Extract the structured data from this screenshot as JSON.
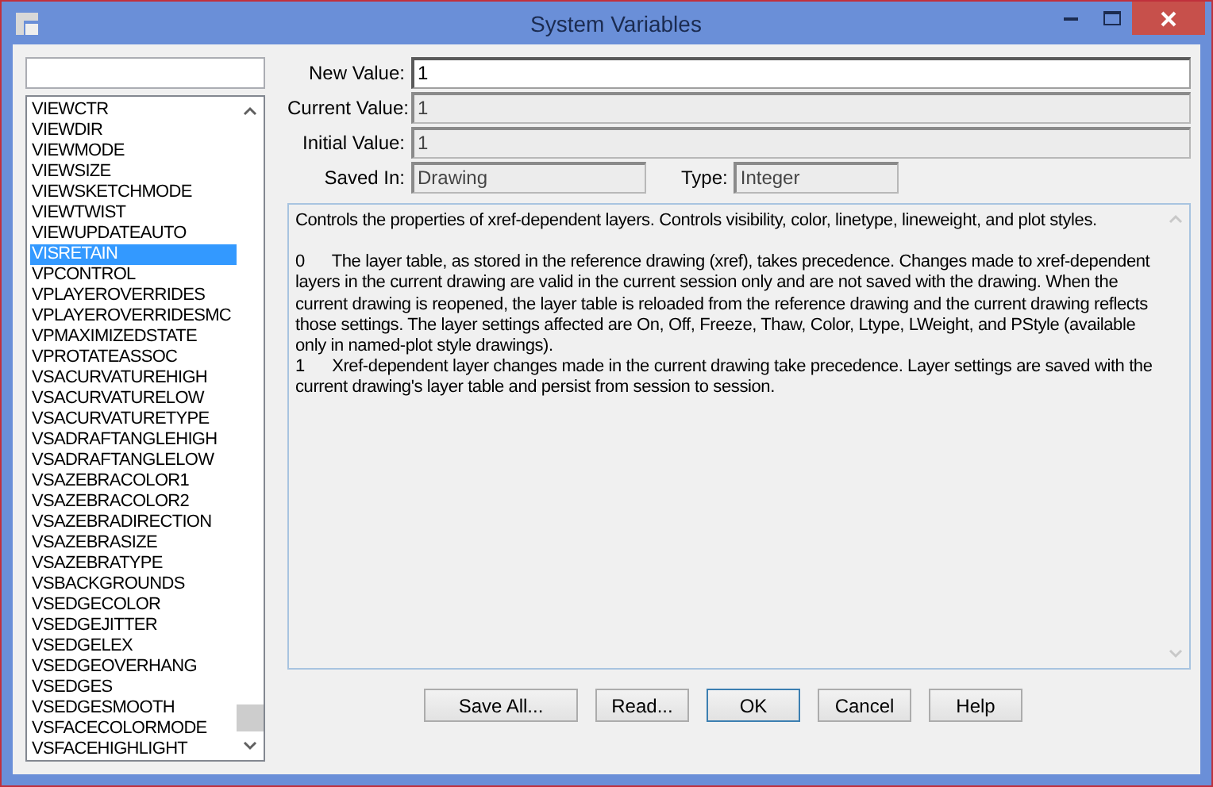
{
  "window": {
    "title": "System Variables"
  },
  "variables": [
    {
      "name": "VIEWCTR",
      "selected": false
    },
    {
      "name": "VIEWDIR",
      "selected": false
    },
    {
      "name": "VIEWMODE",
      "selected": false
    },
    {
      "name": "VIEWSIZE",
      "selected": false
    },
    {
      "name": "VIEWSKETCHMODE",
      "selected": false
    },
    {
      "name": "VIEWTWIST",
      "selected": false
    },
    {
      "name": "VIEWUPDATEAUTO",
      "selected": false
    },
    {
      "name": "VISRETAIN",
      "selected": true
    },
    {
      "name": "VPCONTROL",
      "selected": false
    },
    {
      "name": "VPLAYEROVERRIDES",
      "selected": false
    },
    {
      "name": "VPLAYEROVERRIDESMC",
      "selected": false
    },
    {
      "name": "VPMAXIMIZEDSTATE",
      "selected": false
    },
    {
      "name": "VPROTATEASSOC",
      "selected": false
    },
    {
      "name": "VSACURVATUREHIGH",
      "selected": false
    },
    {
      "name": "VSACURVATURELOW",
      "selected": false
    },
    {
      "name": "VSACURVATURETYPE",
      "selected": false
    },
    {
      "name": "VSADRAFTANGLEHIGH",
      "selected": false
    },
    {
      "name": "VSADRAFTANGLELOW",
      "selected": false
    },
    {
      "name": "VSAZEBRACOLOR1",
      "selected": false
    },
    {
      "name": "VSAZEBRACOLOR2",
      "selected": false
    },
    {
      "name": "VSAZEBRADIRECTION",
      "selected": false
    },
    {
      "name": "VSAZEBRASIZE",
      "selected": false
    },
    {
      "name": "VSAZEBRATYPE",
      "selected": false
    },
    {
      "name": "VSBACKGROUNDS",
      "selected": false
    },
    {
      "name": "VSEDGECOLOR",
      "selected": false
    },
    {
      "name": "VSEDGEJITTER",
      "selected": false
    },
    {
      "name": "VSEDGELEX",
      "selected": false
    },
    {
      "name": "VSEDGEOVERHANG",
      "selected": false
    },
    {
      "name": "VSEDGES",
      "selected": false
    },
    {
      "name": "VSEDGESMOOTH",
      "selected": false
    },
    {
      "name": "VSFACECOLORMODE",
      "selected": false
    },
    {
      "name": "VSFACEHIGHLIGHT",
      "selected": false
    }
  ],
  "fields": [
    {
      "label": "New Value:",
      "value": "1",
      "disabled": false
    },
    {
      "label": "Current Value:",
      "value": "1",
      "disabled": true
    },
    {
      "label": "Initial Value:",
      "value": "1",
      "disabled": true
    }
  ],
  "saved_in": {
    "label": "Saved In:",
    "value": "Drawing"
  },
  "type": {
    "label": "Type:",
    "value": "Integer"
  },
  "description": {
    "summary": "Controls the properties of xref-dependent layers. Controls visibility, color, linetype, lineweight, and plot styles.",
    "options": [
      {
        "value": "0",
        "text": "The layer table, as stored in the reference drawing (xref), takes precedence. Changes made to xref-dependent layers in the current drawing are valid in the current session only and are not saved with the drawing. When the current drawing is reopened, the layer table is reloaded from the reference drawing and the current drawing reflects those settings. The layer settings affected are On, Off, Freeze, Thaw, Color, Ltype, LWeight, and PStyle (available only in named-plot style drawings)."
      },
      {
        "value": "1",
        "text": "Xref-dependent layer changes made in the current drawing take precedence. Layer settings are saved with the current drawing's layer table and persist from session to session."
      }
    ]
  },
  "buttons": [
    {
      "label": "Save All...",
      "default": false
    },
    {
      "label": "Read...",
      "default": false
    },
    {
      "label": "OK",
      "default": true
    },
    {
      "label": "Cancel",
      "default": false
    },
    {
      "label": "Help",
      "default": false
    }
  ]
}
